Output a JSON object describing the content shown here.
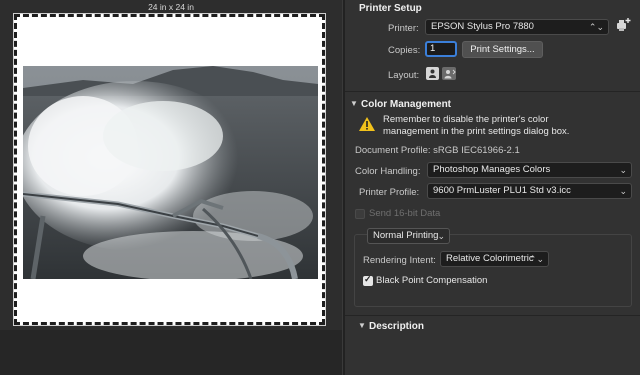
{
  "preview": {
    "size_label": "24 in x 24 in"
  },
  "printer_setup": {
    "heading": "Printer Setup",
    "printer_label": "Printer:",
    "printer_value": "EPSON Stylus Pro 7880",
    "copies_label": "Copies:",
    "copies_value": "1",
    "print_settings_button": "Print Settings...",
    "layout_label": "Layout:",
    "add_printer_icon": "add-printer-icon",
    "layout_icons": [
      "portrait-orientation-icon",
      "landscape-orientation-icon"
    ]
  },
  "color_management": {
    "heading": "Color Management",
    "warning_text_line1": "Remember to disable the printer's color",
    "warning_text_line2": "management in the print settings dialog box.",
    "document_profile": "Document Profile: sRGB IEC61966-2.1",
    "color_handling_label": "Color Handling:",
    "color_handling_value": "Photoshop Manages Colors",
    "printer_profile_label": "Printer Profile:",
    "printer_profile_value": "9600 PrmLuster PLU1 Std v3.icc",
    "send_16bit_label": "Send 16-bit Data",
    "send_16bit_checked": false,
    "proof_mode_value": "Normal Printing",
    "rendering_intent_label": "Rendering Intent:",
    "rendering_intent_value": "Relative Colorimetric",
    "black_point_label": "Black Point Compensation",
    "black_point_checked": true
  },
  "description": {
    "heading": "Description"
  },
  "colors": {
    "panel_bg": "#323232",
    "preview_bg": "#2d2d2d",
    "popup_bg": "#1d1d1d",
    "warning_yellow": "#f2c21b",
    "focus_blue": "#3b7fd9"
  }
}
